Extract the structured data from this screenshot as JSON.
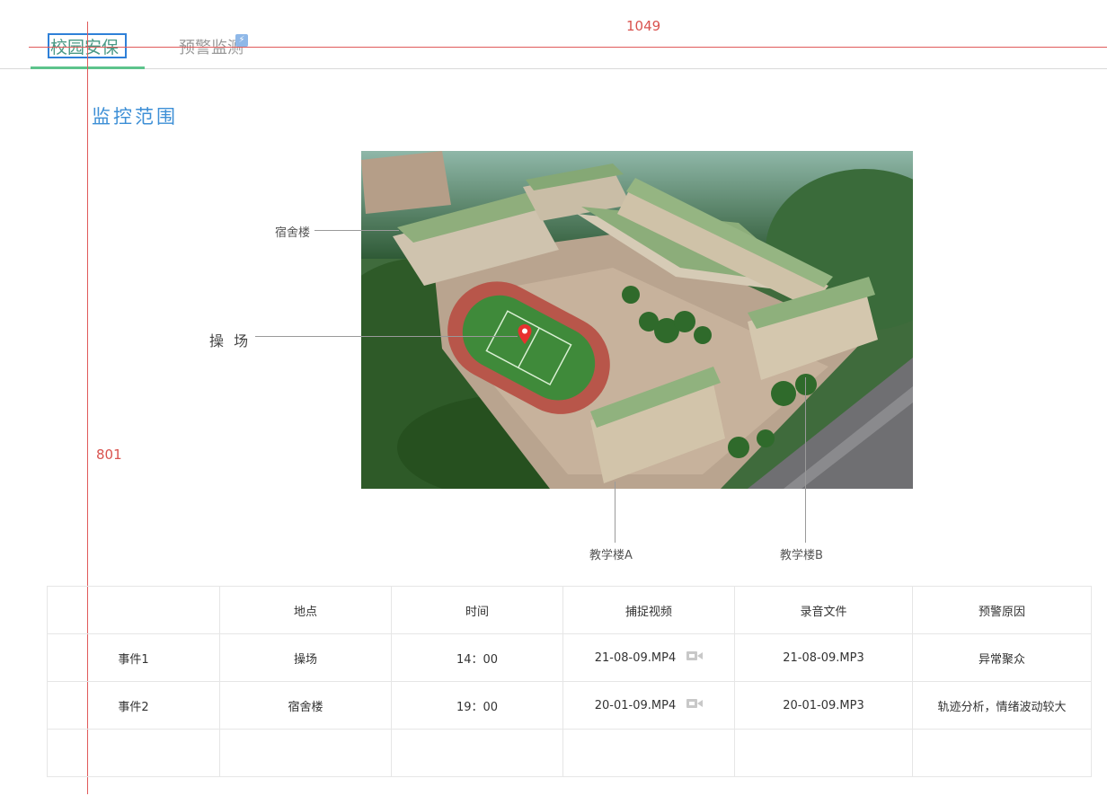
{
  "tabs": [
    {
      "label": "校园安保",
      "active": true
    },
    {
      "label": "预警监测",
      "active": false,
      "badge_icon": "lightning-icon"
    }
  ],
  "guides": {
    "h_value": "1049",
    "v_value": "801",
    "color": "#e05a5a"
  },
  "section_title": "监控范围",
  "map": {
    "pin_icon": "map-pin-icon",
    "pin_color": "#e8312f",
    "callouts": {
      "dorm": "宿舍楼",
      "playground": "操 场",
      "teach_a": "教学楼A",
      "teach_b": "教学楼B"
    }
  },
  "table": {
    "headers": [
      "",
      "地点",
      "时间",
      "捕捉视频",
      "录音文件",
      "预警原因"
    ],
    "rows": [
      {
        "event": "事件1",
        "location": "操场",
        "time": "14：00",
        "video": "21-08-09.MP4",
        "audio": "21-08-09.MP3",
        "reason": "异常聚众"
      },
      {
        "event": "事件2",
        "location": "宿舍楼",
        "time": "19：00",
        "video": "20-01-09.MP4",
        "audio": "20-01-09.MP3",
        "reason": "轨迹分析，情绪波动较大"
      }
    ],
    "video_icon": "video-camera-icon"
  },
  "colors": {
    "accent": "#3d8fd6",
    "tab_active": "#4a9a86",
    "tab_underline": "#5dc48c"
  }
}
